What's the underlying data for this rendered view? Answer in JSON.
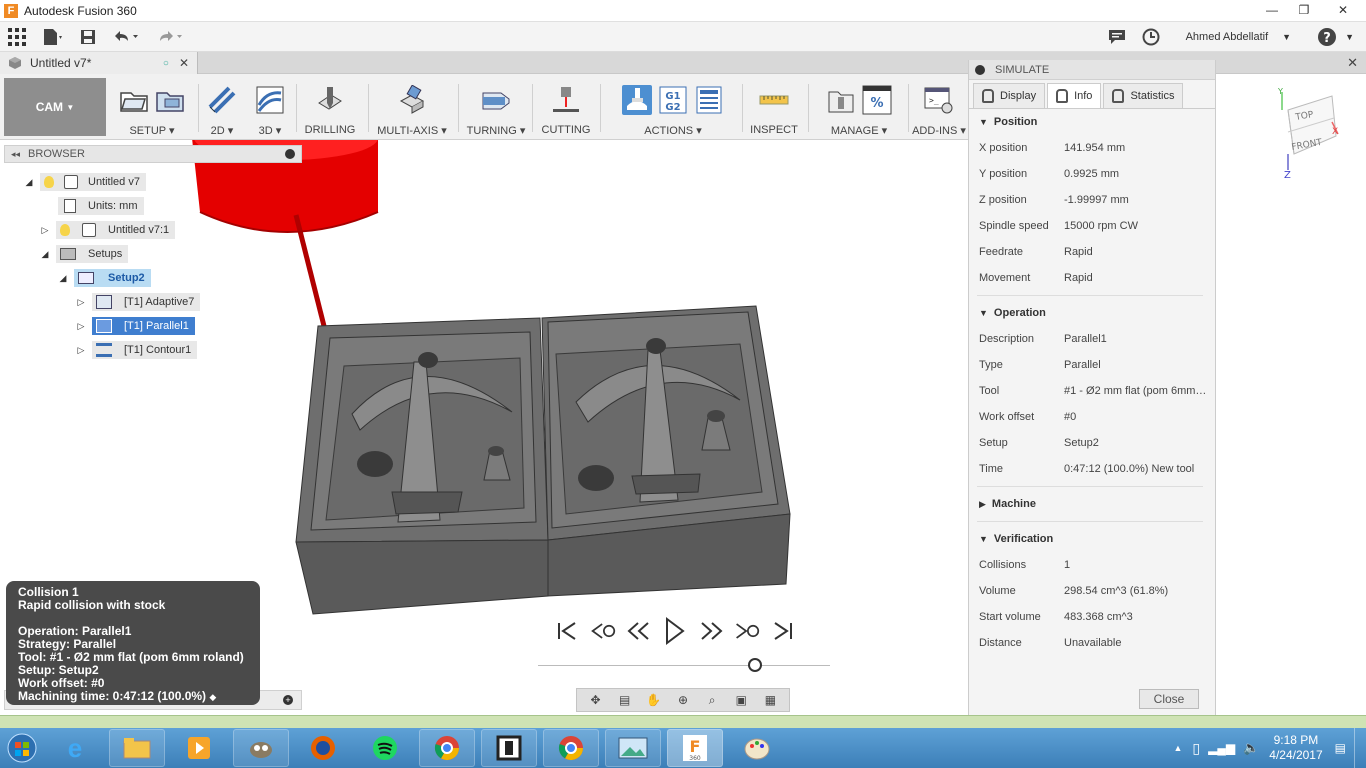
{
  "window": {
    "title": "Autodesk Fusion 360",
    "minimize": "—",
    "maximize": "❐",
    "close": "✕"
  },
  "qat": {
    "user_name": "Ahmed Abdellatif",
    "help": "?"
  },
  "doc_tab": {
    "name": "Untitled v7*",
    "close": "✕"
  },
  "toolbar": {
    "workspace": "CAM",
    "groups": [
      "SETUP",
      "2D",
      "3D",
      "DRILLING",
      "MULTI-AXIS",
      "TURNING",
      "CUTTING",
      "ACTIONS",
      "INSPECT",
      "MANAGE",
      "ADD-INS"
    ],
    "g1g2": [
      "G1",
      "G2"
    ]
  },
  "browser": {
    "title": "BROWSER",
    "nodes": {
      "root": "Untitled v7",
      "units": "Units: mm",
      "component": "Untitled v7:1",
      "setups": "Setups",
      "setup2": "Setup2",
      "op1": "[T1] Adaptive7",
      "op2": "[T1] Parallel1",
      "op3": "[T1] Contour1"
    }
  },
  "simulate": {
    "title": "SIMULATE",
    "tabs": [
      "Display",
      "Info",
      "Statistics"
    ],
    "position": {
      "title": "Position",
      "rows": [
        [
          "X position",
          "141.954 mm"
        ],
        [
          "Y position",
          "0.9925 mm"
        ],
        [
          "Z position",
          "-1.99997 mm"
        ],
        [
          "Spindle speed",
          "15000 rpm CW"
        ],
        [
          "Feedrate",
          "Rapid"
        ],
        [
          "Movement",
          "Rapid"
        ]
      ]
    },
    "operation": {
      "title": "Operation",
      "rows": [
        [
          "Description",
          "Parallel1"
        ],
        [
          "Type",
          "Parallel"
        ],
        [
          "Tool",
          "#1 - Ø2 mm flat (pom 6mm r..."
        ],
        [
          "Work offset",
          "#0"
        ],
        [
          "Setup",
          "Setup2"
        ],
        [
          "Time",
          "0:47:12 (100.0%) New tool"
        ]
      ]
    },
    "machine": {
      "title": "Machine"
    },
    "verification": {
      "title": "Verification",
      "rows": [
        [
          "Collisions",
          "1"
        ],
        [
          "Volume",
          "298.54 cm^3 (61.8%)"
        ],
        [
          "Start volume",
          "483.368 cm^3"
        ],
        [
          "Distance",
          "Unavailable"
        ]
      ]
    },
    "close": "Close"
  },
  "viewcube": {
    "top": "TOP",
    "front": "FRONT",
    "x": "X",
    "y": "Y",
    "z": "Z"
  },
  "tooltip": {
    "line1": "Collision 1",
    "line2": "Rapid collision with stock",
    "line3": "Operation: Parallel1",
    "line4": "Strategy: Parallel",
    "line5": "Tool: #1 - Ø2 mm flat (pom 6mm roland)",
    "line6": "Setup: Setup2",
    "line7": "Work offset: #0",
    "line8": "Machining time: 0:47:12 (100.0%)"
  },
  "taskbar": {
    "time": "9:18 PM",
    "date": "4/24/2017",
    "fusion_badge": "360"
  },
  "colors": {
    "accent": "#3f7ecf",
    "workspace": "#8e8e8e",
    "tool_red": "#e00000",
    "stock": "#5e5e5e"
  }
}
